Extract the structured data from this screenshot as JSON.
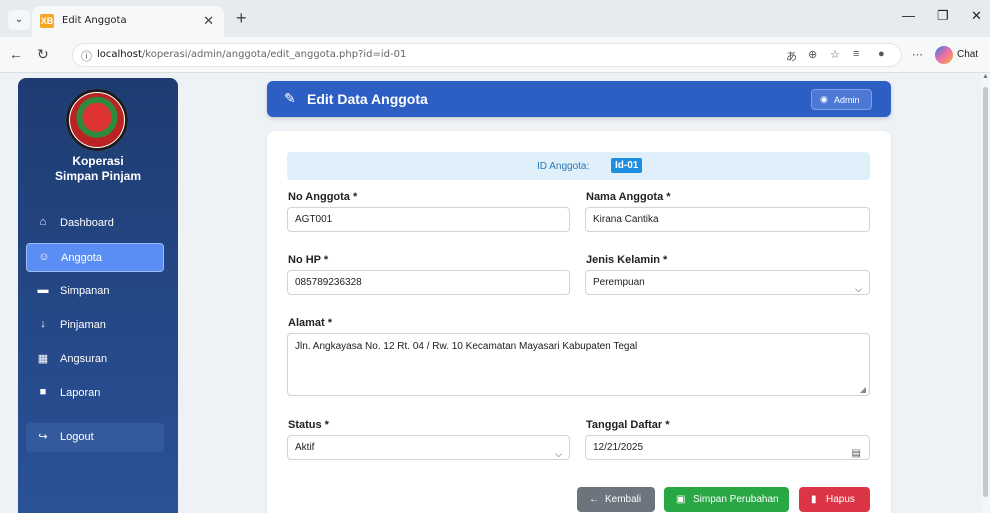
{
  "browser": {
    "tab_title": "Edit Anggota",
    "favicon": "XB",
    "url_host": "localhost",
    "url_path": "/koperasi/admin/anggota/edit_anggota.php?id=id-01",
    "chat_label": "Chat"
  },
  "sidebar": {
    "brand": "Koperasi\nSimpan Pinjam",
    "brand_line1": "Koperasi",
    "brand_line2": "Simpan Pinjam",
    "items": [
      {
        "label": "Dashboard",
        "icon": "home-icon"
      },
      {
        "label": "Anggota",
        "icon": "users-icon",
        "active": true
      },
      {
        "label": "Simpanan",
        "icon": "wallet-icon"
      },
      {
        "label": "Pinjaman",
        "icon": "hand-holding-icon"
      },
      {
        "label": "Angsuran",
        "icon": "calendar-icon"
      },
      {
        "label": "Laporan",
        "icon": "file-icon"
      }
    ],
    "logout": "Logout"
  },
  "header": {
    "title": "Edit Data Anggota",
    "admin_label": "Admin"
  },
  "form": {
    "id_label": "ID Anggota:",
    "id_value": "Id-01",
    "no_anggota": {
      "label": "No Anggota *",
      "value": "AGT001"
    },
    "nama_anggota": {
      "label": "Nama Anggota *",
      "value": "Kirana Cantika"
    },
    "no_hp": {
      "label": "No HP *",
      "value": "085789236328"
    },
    "jenis_kelamin": {
      "label": "Jenis Kelamin *",
      "value": "Perempuan"
    },
    "alamat": {
      "label": "Alamat *",
      "value": "Jln. Angkayasa No. 12 Rt. 04 / Rw. 10 Kecamatan Mayasari Kabupaten Tegal"
    },
    "status": {
      "label": "Status *",
      "value": "Aktif"
    },
    "tanggal_daftar": {
      "label": "Tanggal Daftar *",
      "value": "12/21/2025"
    }
  },
  "buttons": {
    "kembali": "Kembali",
    "simpan": "Simpan Perubahan",
    "hapus": "Hapus"
  },
  "colors": {
    "sidebar_top": "#1e3c72",
    "header": "#2d5ec3",
    "btn_kembali": "#6c757d",
    "btn_simpan": "#28a745",
    "btn_hapus": "#dc3545"
  }
}
